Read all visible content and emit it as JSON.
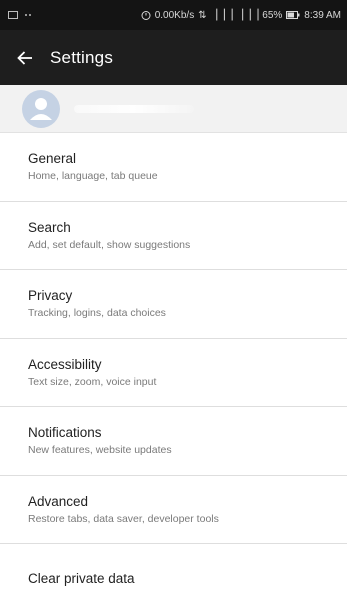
{
  "status_bar": {
    "network_speed": "0.00Kb/s",
    "signal": "⇅ ▕▕▕ ▕▕▕",
    "battery": "65%",
    "time": "8:39 AM"
  },
  "toolbar": {
    "back_icon": "arrow-left-icon",
    "title": "Settings"
  },
  "account": {
    "avatar_icon": "default-avatar-icon"
  },
  "items": [
    {
      "title": "General",
      "subtitle": "Home, language, tab queue"
    },
    {
      "title": "Search",
      "subtitle": "Add, set default, show suggestions"
    },
    {
      "title": "Privacy",
      "subtitle": "Tracking, logins, data choices"
    },
    {
      "title": "Accessibility",
      "subtitle": "Text size, zoom, voice input"
    },
    {
      "title": "Notifications",
      "subtitle": "New features, website updates"
    },
    {
      "title": "Advanced",
      "subtitle": "Restore tabs, data saver, developer tools"
    },
    {
      "title": "Clear private data",
      "subtitle": ""
    }
  ],
  "colors": {
    "toolbar": "#1e1e1e",
    "status_bar": "#141414",
    "avatar": "#c5d2e4"
  }
}
